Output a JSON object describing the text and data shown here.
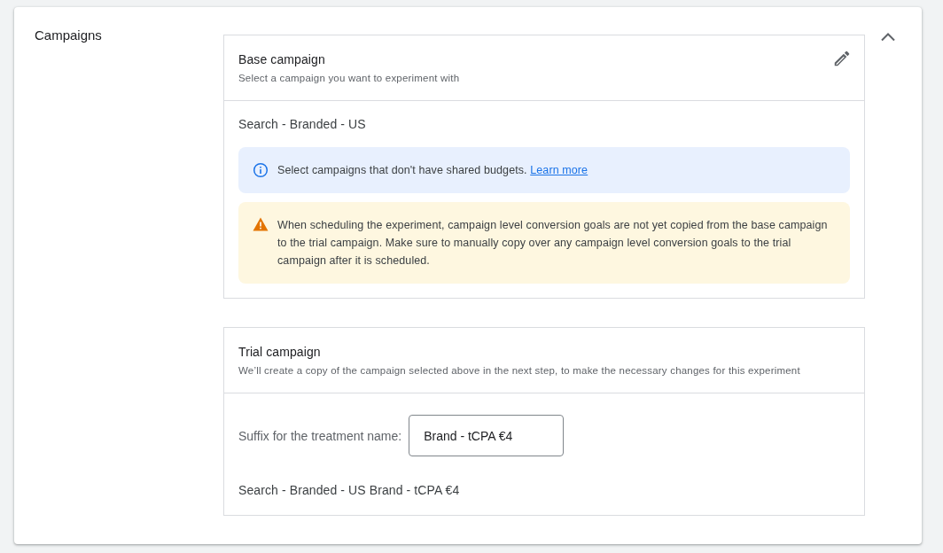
{
  "section": {
    "title": "Campaigns",
    "expanded": true
  },
  "base_campaign": {
    "title": "Base campaign",
    "subtitle": "Select a campaign you want to experiment with",
    "value": "Search - Branded - US",
    "notices": [
      {
        "kind": "info",
        "text": "Select campaigns that don't have shared budgets.",
        "link": "Learn more"
      },
      {
        "kind": "warning",
        "text": "When scheduling the experiment, campaign level conversion goals are not yet copied from the base campaign to the trial campaign. Make sure to manually copy over any campaign level conversion goals to the trial campaign after it is scheduled."
      }
    ]
  },
  "trial_campaign": {
    "title": "Trial campaign",
    "subtitle": "We’ll create a copy of the campaign selected above in the next step, to make the necessary changes for this experiment",
    "suffix_label": "Suffix for the treatment name:",
    "suffix_value": "Brand - tCPA €4",
    "result_name": "Search - Branded - US Brand - tCPA €4"
  }
}
